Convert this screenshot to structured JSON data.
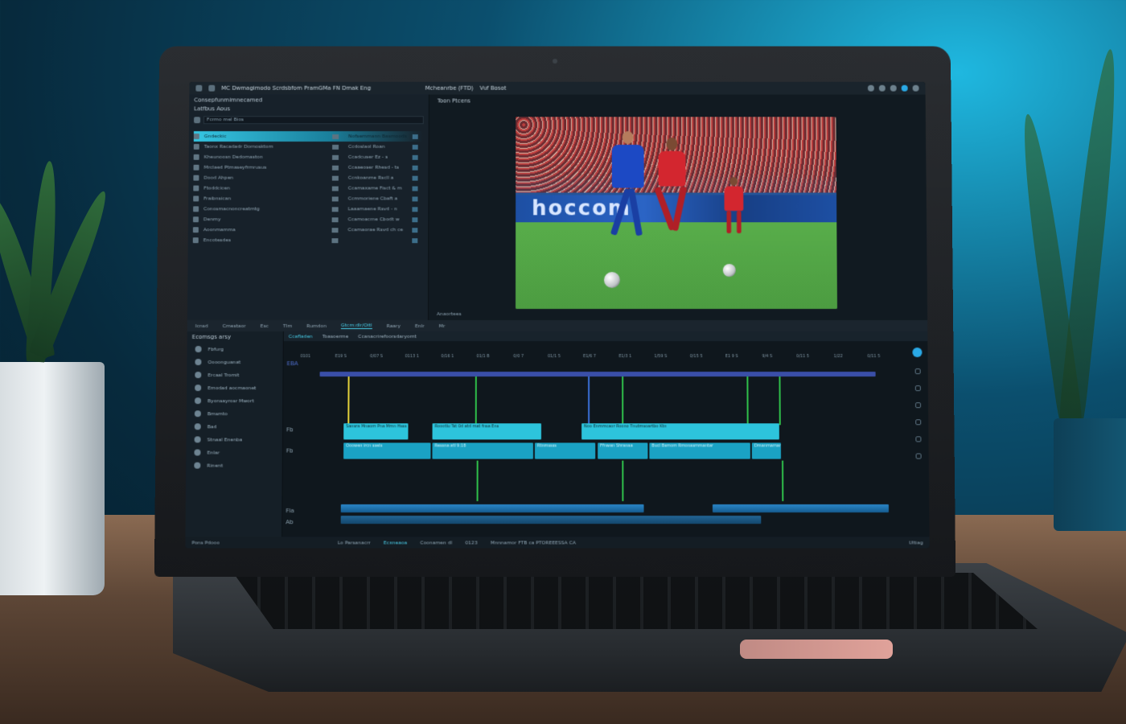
{
  "window": {
    "title": "MC Dwmagimodo Scrdsbfom PramGMa FN Dmak Eng",
    "project_tab": "Mcheanrbe (FTD)",
    "project_sub": "Vuf Bosot"
  },
  "browser": {
    "title": "Consepfunmimnecamed",
    "subtitle": "Latfbus Aous",
    "search_placeholder": "Fcrmo mel Bios",
    "items": [
      {
        "name": "Gndeckic",
        "type": "Nofsemmann Basmoods"
      },
      {
        "name": "Taonx Racadadr Dornosktom",
        "type": "Ccdoslaol Roan"
      },
      {
        "name": "Kheunoosn Dedomaston",
        "type": "Ccadcuser Ez - s"
      },
      {
        "name": "Mrclaed Ptmaseyfrmrusus",
        "type": "Ccaaeoser Rhesd - ts"
      },
      {
        "name": "Dood Ahpen",
        "type": "Ccnkoanme Rscll a"
      },
      {
        "name": "Ftoddcicen",
        "type": "Ccamaxame Fisct & m"
      },
      {
        "name": "Fraibnsican",
        "type": "Ccmmoriene Cbaft a"
      },
      {
        "name": "Conosmacnoncreatmtg",
        "type": "Laaamaene Rsvd - n"
      },
      {
        "name": "Denmy",
        "type": "Ccamoacrne Cbodt w"
      },
      {
        "name": "Aoonmamma",
        "type": "Ccamaorae Rsvd ch ce"
      },
      {
        "name": "Encotesdes",
        "type": ""
      }
    ]
  },
  "viewer": {
    "header": "Toon Ptcens",
    "footer": "Anaortees",
    "board_text": "hoccom"
  },
  "toolbar2": {
    "items": [
      "Icnsd",
      "Cmestaor",
      "Esc",
      "Tlm",
      "Rumdon",
      "Gtcm:dlr/Oitl",
      "Raary",
      "Enlr",
      "Mr"
    ]
  },
  "effects": {
    "title": "Ecomsgs arsy",
    "items": [
      "Fbfurg",
      "Oooonguanat",
      "Ercaal Tromit",
      "Emodad aocmaonet",
      "Byonsayrosr Mwort",
      "Bmsmto",
      "Bad",
      "Stnaal Enenba",
      "Enlar",
      "Rinent"
    ]
  },
  "timeline": {
    "tabs": [
      "Ccafladen",
      "Toasoerme",
      "Ccanacrirefoorsdaryomt"
    ],
    "ruler": [
      "0101",
      "E19 S",
      "0/07 S",
      "0113 1",
      "0/16 1",
      "01/1 B",
      "0/0 7",
      "01/1 5",
      "E1/6 7",
      "E1/3 1",
      "1/59 S",
      "0/15 5",
      "E1 9 S",
      "9/4 S",
      "0/11 5",
      "1/22",
      "0/11 5"
    ],
    "playhead_label": "EBA",
    "clips_v1": [
      "Sansra Mnaom Pna Mmn Hsss",
      "Roootlu Tst 0d atd mat fnsa Ens",
      "Noo Enmmcaor Roono Tnutmsoartbo Ktn"
    ],
    "clips_v2": [
      "Ooowen ircn ssels",
      "Ressna atl 9:18",
      "Rtnmssss",
      "Ffnwan Shranaa",
      "Bucl Bsmom Rmonasmmantar",
      "Dmanmamand"
    ],
    "track_labels": [
      "Fb",
      "Fb",
      "Fla",
      "Ab"
    ]
  },
  "statusbar": {
    "left": "Pons Pdooo",
    "tabs": [
      "Lo Parsanacrr",
      "Ecxneaoa",
      "Coonamen dl"
    ],
    "timecode": "0123",
    "message": "Mnnnamor FTB ca PTOREEESSA CA",
    "right": "Ultiag"
  },
  "colors": {
    "accent": "#2dc4dc",
    "work_area": "#3a4fa8",
    "marker_green": "#2fbf4a",
    "playhead": "#e2d13a"
  }
}
